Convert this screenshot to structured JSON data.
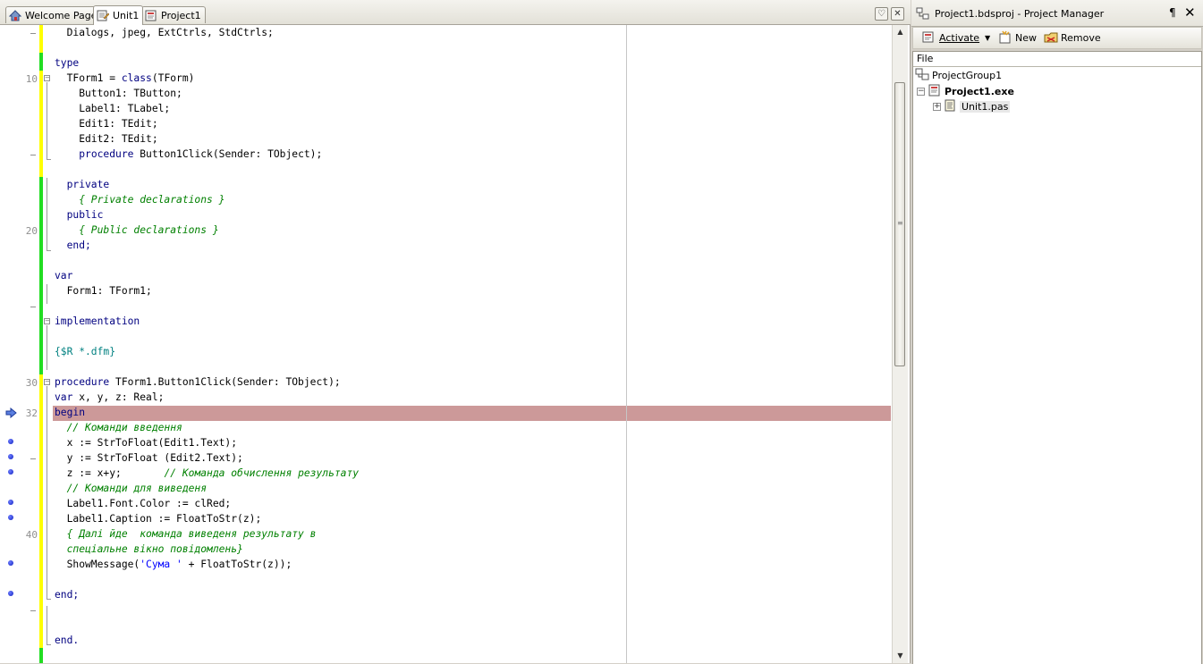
{
  "editor_tabs": [
    {
      "label": "Welcome Page",
      "icon": "home-icon"
    },
    {
      "label": "Unit1",
      "icon": "unit-file-icon",
      "active": true
    },
    {
      "label": "Project1",
      "icon": "project-file-icon"
    }
  ],
  "editor": {
    "line_numbers": [
      "10",
      "20",
      "30",
      "32",
      "40"
    ],
    "code_lines": [
      [
        {
          "t": "  Dialogs, jpeg, ExtCtrls, StdCtrls;",
          "c": ""
        }
      ],
      [],
      [
        {
          "t": "type",
          "c": "kw"
        }
      ],
      [
        {
          "t": "  TForm1 = ",
          "c": ""
        },
        {
          "t": "class",
          "c": "kw"
        },
        {
          "t": "(TForm)",
          "c": ""
        }
      ],
      [
        {
          "t": "    Button1: TButton;",
          "c": ""
        }
      ],
      [
        {
          "t": "    Label1: TLabel;",
          "c": ""
        }
      ],
      [
        {
          "t": "    Edit1: TEdit;",
          "c": ""
        }
      ],
      [
        {
          "t": "    Edit2: TEdit;",
          "c": ""
        }
      ],
      [
        {
          "t": "    ",
          "c": ""
        },
        {
          "t": "procedure",
          "c": "kw"
        },
        {
          "t": " Button1Click(Sender: TObject);",
          "c": ""
        }
      ],
      [],
      [
        {
          "t": "  private",
          "c": "kw"
        }
      ],
      [
        {
          "t": "    { Private declarations }",
          "c": "cm"
        }
      ],
      [
        {
          "t": "  public",
          "c": "kw"
        }
      ],
      [
        {
          "t": "    { Public declarations }",
          "c": "cm"
        }
      ],
      [
        {
          "t": "  end;",
          "c": "kw"
        }
      ],
      [],
      [
        {
          "t": "var",
          "c": "kw"
        }
      ],
      [
        {
          "t": "  Form1: TForm1;",
          "c": ""
        }
      ],
      [],
      [
        {
          "t": "implementation",
          "c": "kw"
        }
      ],
      [],
      [
        {
          "t": "{$R *.dfm}",
          "c": "dr"
        }
      ],
      [],
      [
        {
          "t": "procedure",
          "c": "kw"
        },
        {
          "t": " TForm1.Button1Click(Sender: TObject);",
          "c": ""
        }
      ],
      [
        {
          "t": "var",
          "c": "kw"
        },
        {
          "t": " x, y, z: Real;",
          "c": ""
        }
      ],
      [
        {
          "t": "begin",
          "c": "kw"
        }
      ],
      [
        {
          "t": "  // Команди введення",
          "c": "cm"
        }
      ],
      [
        {
          "t": "  x := StrToFloat(Edit1.Text);",
          "c": ""
        }
      ],
      [
        {
          "t": "  y := StrToFloat (Edit2.Text);",
          "c": ""
        }
      ],
      [
        {
          "t": "  z := x+y;       ",
          "c": ""
        },
        {
          "t": "// Команда обчислення результату",
          "c": "cm"
        }
      ],
      [
        {
          "t": "  // Команди для виведеня",
          "c": "cm"
        }
      ],
      [
        {
          "t": "  Label1.Font.Color := clRed;",
          "c": ""
        }
      ],
      [
        {
          "t": "  Label1.Caption := FloatToStr(z);",
          "c": ""
        }
      ],
      [
        {
          "t": "  { Далі йде  команда виведеня результату в",
          "c": "cm"
        }
      ],
      [
        {
          "t": "  спеціальне вікно повідомлень}",
          "c": "cm"
        }
      ],
      [
        {
          "t": "  ShowMessage(",
          "c": ""
        },
        {
          "t": "'Сума '",
          "c": "st"
        },
        {
          "t": " + FloatToStr(z));",
          "c": ""
        }
      ],
      [],
      [
        {
          "t": "end;",
          "c": "kw"
        }
      ],
      [],
      [],
      [
        {
          "t": "end.",
          "c": "kw"
        }
      ]
    ]
  },
  "colors": {
    "keyword": "#000080",
    "comment": "#008000",
    "directive": "#008080",
    "string": "#0000ff",
    "execution_line": "#cc9999",
    "modified_bar": "#ffff00",
    "saved_bar": "#22dd22"
  },
  "project_manager": {
    "title": "Project1.bdsproj - Project Manager",
    "pin_icon": "pin-icon",
    "close_icon": "close-icon",
    "toolbar": {
      "activate": "Activate",
      "new": "New",
      "remove": "Remove"
    },
    "column_header": "File",
    "tree": {
      "group": "ProjectGroup1",
      "project": "Project1.exe",
      "unit": "Unit1.pas"
    }
  }
}
